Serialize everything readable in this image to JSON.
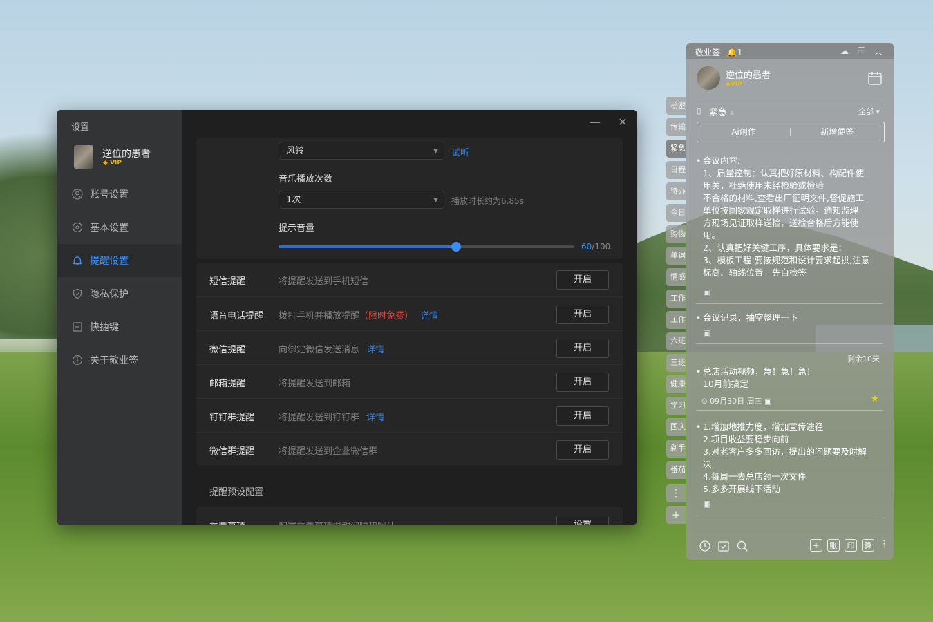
{
  "settings": {
    "title": "设置",
    "user": {
      "name": "逆位的愚者",
      "badge": "VIP"
    },
    "nav": [
      {
        "label": "账号设置",
        "icon": "user-circle-icon"
      },
      {
        "label": "基本设置",
        "icon": "gear-icon"
      },
      {
        "label": "提醒设置",
        "icon": "bell-icon",
        "active": true
      },
      {
        "label": "隐私保护",
        "icon": "shield-icon"
      },
      {
        "label": "快捷键",
        "icon": "keyboard-icon"
      },
      {
        "label": "关于敬业签",
        "icon": "info-icon"
      }
    ],
    "window_controls": {
      "minimize": "—",
      "close": "✕"
    },
    "ringtone": {
      "value": "风铃",
      "preview_link": "试听"
    },
    "play_count": {
      "label": "音乐播放次数",
      "value": "1次",
      "hint": "播放时长约为6.85s"
    },
    "volume": {
      "label": "提示音量",
      "value": 60,
      "max": 100,
      "value_text": "60",
      "max_text": "/100"
    },
    "reminders": [
      {
        "name": "短信提醒",
        "desc": "将提醒发送到手机短信",
        "button": "开启"
      },
      {
        "name": "语音电话提醒",
        "desc": "拨打手机并播放提醒",
        "promo": "（限时免费）",
        "detail": "详情",
        "button": "开启"
      },
      {
        "name": "微信提醒",
        "desc": "向绑定微信发送消息",
        "detail": "详情",
        "button": "开启"
      },
      {
        "name": "邮箱提醒",
        "desc": "将提醒发送到邮箱",
        "button": "开启"
      },
      {
        "name": "钉钉群提醒",
        "desc": "将提醒发送到钉钉群",
        "detail": "详情",
        "button": "开启"
      },
      {
        "name": "微信群提醒",
        "desc": "将提醒发送到企业微信群",
        "button": "开启"
      }
    ],
    "preset_section": "提醒预设配置",
    "preset_row": {
      "name": "重要事项",
      "desc": "配置重要事项提醒间隔和默认",
      "button": "设置"
    }
  },
  "note": {
    "app_name": "敬业签",
    "notify_count": "1",
    "user": {
      "name": "逆位的愚者",
      "badge": "VIP"
    },
    "category": {
      "name": "紧急",
      "count": "4",
      "filter": "全部"
    },
    "actions": {
      "ai": "Ai创作",
      "new": "新增便签"
    },
    "side_tabs": [
      "秘密",
      "传输",
      "紧急",
      "日程",
      "待办",
      "今日",
      "购物",
      "单词",
      "情感",
      "工作",
      "工作",
      "六班",
      "三班",
      "健康",
      "学习",
      "国庆",
      "剁手",
      "番茄"
    ],
    "items": [
      {
        "lines": [
          "会议内容:",
          "1、质量控制：认真把好原材料、构配件使",
          "用关，杜绝使用未经检验或检验",
          "不合格的材料,查看出厂证明文件,督促施工",
          "单位按国家规定取样进行试验。通知监理",
          "方现场见证取样送检，送检合格后方能使",
          "用。",
          "2、认真把好关键工序，具体要求是：",
          "3、模板工程:要按规范和设计要求起拱,注意",
          "标高、轴线位置。先自检签"
        ]
      },
      {
        "lines": [
          "会议记录，抽空整理一下"
        ]
      },
      {
        "remaining": "剩余10天",
        "lines": [
          "总店活动视频，急！急！急！",
          "10月前搞定"
        ],
        "date": "09月30日 周三"
      },
      {
        "lines": [
          "1.增加地推力度，增加宣传途径",
          "2.项目收益要稳步向前",
          "3.对老客户多多回访，提出的问题要及时解",
          "决",
          "4.每周一去总店领一次文件",
          "5.多多开展线下活动"
        ]
      }
    ],
    "bottom_right_icons": [
      "+",
      "账",
      "印",
      "算"
    ]
  },
  "colors": {
    "accent": "#3a8ef6",
    "promo": "#e0403a",
    "vip": "#f0b400"
  }
}
